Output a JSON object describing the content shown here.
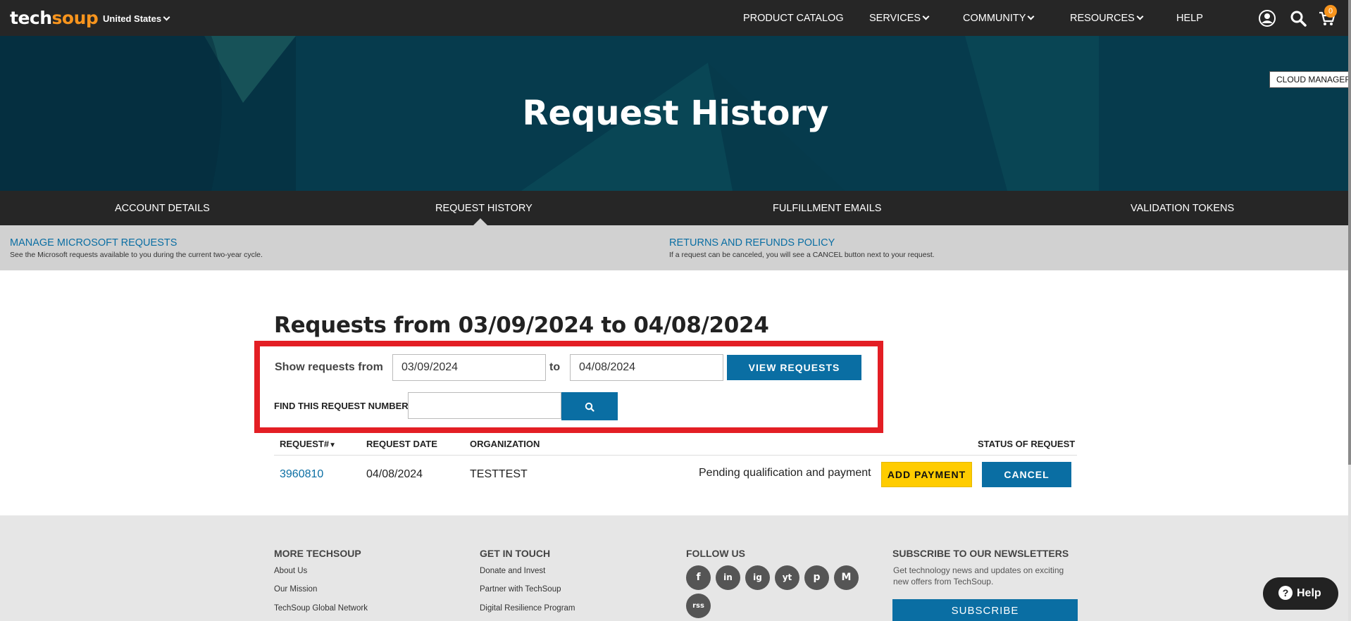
{
  "header": {
    "logo_tech": "tech",
    "logo_soup": "soup",
    "country": "United States",
    "nav": [
      "PRODUCT CATALOG",
      "SERVICES",
      "COMMUNITY",
      "RESOURCES",
      "HELP"
    ],
    "cart_count": "0",
    "icons": [
      "user-icon",
      "search-icon",
      "cart-icon"
    ]
  },
  "hero": {
    "title": "Request History",
    "cloud_manager": "CLOUD MANAGER"
  },
  "tabs": [
    "ACCOUNT DETAILS",
    "REQUEST HISTORY",
    "FULFILLMENT EMAILS",
    "VALIDATION TOKENS"
  ],
  "info": {
    "left_link": "MANAGE MICROSOFT REQUESTS",
    "left_desc": "See the Microsoft requests available to you during the current two-year cycle.",
    "right_link": "RETURNS AND REFUNDS POLICY",
    "right_desc": "If a request can be canceled, you will see a CANCEL button next to your request."
  },
  "main": {
    "title": "Requests from 03/09/2024 to 04/08/2024",
    "show_from_label": "Show requests from",
    "from_date": "03/09/2024",
    "to_label": "to",
    "to_date": "04/08/2024",
    "view_button": "VIEW REQUESTS",
    "find_label": "FIND THIS REQUEST NUMBER",
    "find_value": ""
  },
  "table": {
    "headers": {
      "request": "REQUEST#",
      "date": "REQUEST DATE",
      "org": "ORGANIZATION",
      "status": "STATUS OF REQUEST"
    },
    "rows": [
      {
        "number": "3960810",
        "date": "04/08/2024",
        "org": "TESTTEST",
        "status": "Pending qualification and payment",
        "pay_button": "ADD PAYMENT",
        "cancel_button": "CANCEL"
      }
    ]
  },
  "footer": {
    "col1": {
      "title": "MORE TECHSOUP",
      "links": [
        "About Us",
        "Our Mission",
        "TechSoup Global Network"
      ]
    },
    "col2": {
      "title": "GET IN TOUCH",
      "links": [
        "Donate and Invest",
        "Partner with TechSoup",
        "Digital Resilience Program"
      ]
    },
    "col3": {
      "title": "FOLLOW US",
      "socials": [
        "f",
        "in",
        "ig",
        "yt",
        "p",
        "M",
        "rss"
      ]
    },
    "col4": {
      "title": "SUBSCRIBE TO OUR NEWSLETTERS",
      "text": "Get technology news and updates on exciting new offers from TechSoup.",
      "button": "SUBSCRIBE"
    },
    "help": "Help"
  },
  "colors": {
    "accent_blue": "#0a6ea3",
    "brand_orange": "#f7941d",
    "highlight_red": "#e31e24",
    "pay_yellow": "#ffcc00"
  }
}
